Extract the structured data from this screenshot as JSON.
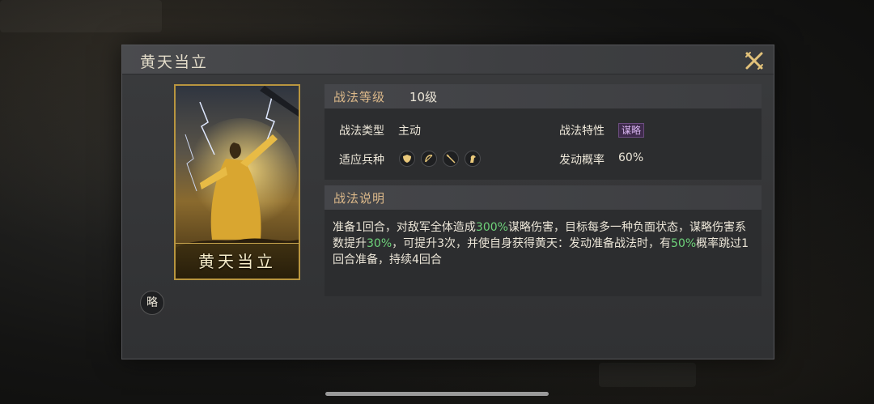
{
  "dialog": {
    "title": "黄天当立"
  },
  "card": {
    "name": "黄天当立",
    "badge": "略"
  },
  "level": {
    "label": "战法等级",
    "value": "10级"
  },
  "attributes": {
    "type_label": "战法类型",
    "type_value": "主动",
    "trait_label": "战法特性",
    "trait_value": "谋略",
    "troops_label": "适应兵种",
    "troop_icons": [
      "shield-icon",
      "bow-icon",
      "spear-icon",
      "horse-icon"
    ],
    "chance_label": "发动概率",
    "chance_value": "60%"
  },
  "description": {
    "label": "战法说明",
    "parts": [
      "准备1回合，对敌军全体造成",
      "300%",
      "谋略伤害，目标每多一种负面状态，谋略伤害系数提升",
      "30%",
      "，可提升3次，并使自身获得黄天：发动准备战法时，有",
      "50%",
      "概率跳过1回合准备，持续4回合"
    ]
  },
  "colors": {
    "highlight": "#6ed37a",
    "section_label": "#dcb98a",
    "card_border": "#b8953f"
  }
}
